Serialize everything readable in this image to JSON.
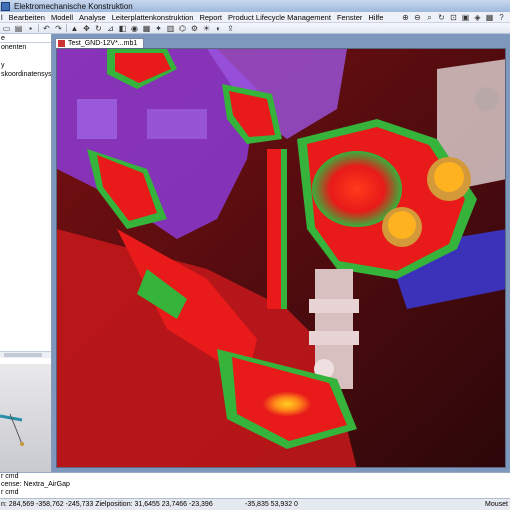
{
  "window": {
    "title": "Elektromechanische Konstruktion"
  },
  "menu": {
    "items": [
      "Bearbeiten",
      "Modell",
      "Analyse",
      "Leiterplattenkonstruktion",
      "Report",
      "Product Lifecycle Management",
      "Fenster",
      "Hilfe"
    ],
    "partial_first": "l"
  },
  "toolbar": {
    "icons": [
      "new-icon",
      "open-icon",
      "save-icon",
      "undo-icon",
      "redo-icon",
      "select-icon",
      "move-icon",
      "rotate-icon",
      "zoom-icon",
      "pan-icon",
      "fit-icon",
      "measure-icon",
      "section-icon",
      "view-icon",
      "render-icon"
    ]
  },
  "tree": {
    "combo_value": "e",
    "items": [
      "onenten",
      "",
      "y",
      "skoordinatensyste",
      "",
      "",
      ""
    ]
  },
  "viewport": {
    "tab_label": "Test_GND-12V*...mb1"
  },
  "output": {
    "lines": [
      "r cmd",
      "cense: Nextra_AirGap",
      "r cmd"
    ]
  },
  "status": {
    "coords": "n: 284,569 -358,762 -245,733 Zielposition: 31,6455 23,7466 -23,396",
    "coords2": "-35,835 53,932 0",
    "mouse": "Mouset"
  },
  "colors": {
    "heat_red": "#e81a1a",
    "heat_green": "#35b33a",
    "heat_yellow": "#ffd11f",
    "part_purple": "#8b3ad6",
    "part_blue": "#3b3ad8",
    "part_grey": "#d8c8c8"
  }
}
